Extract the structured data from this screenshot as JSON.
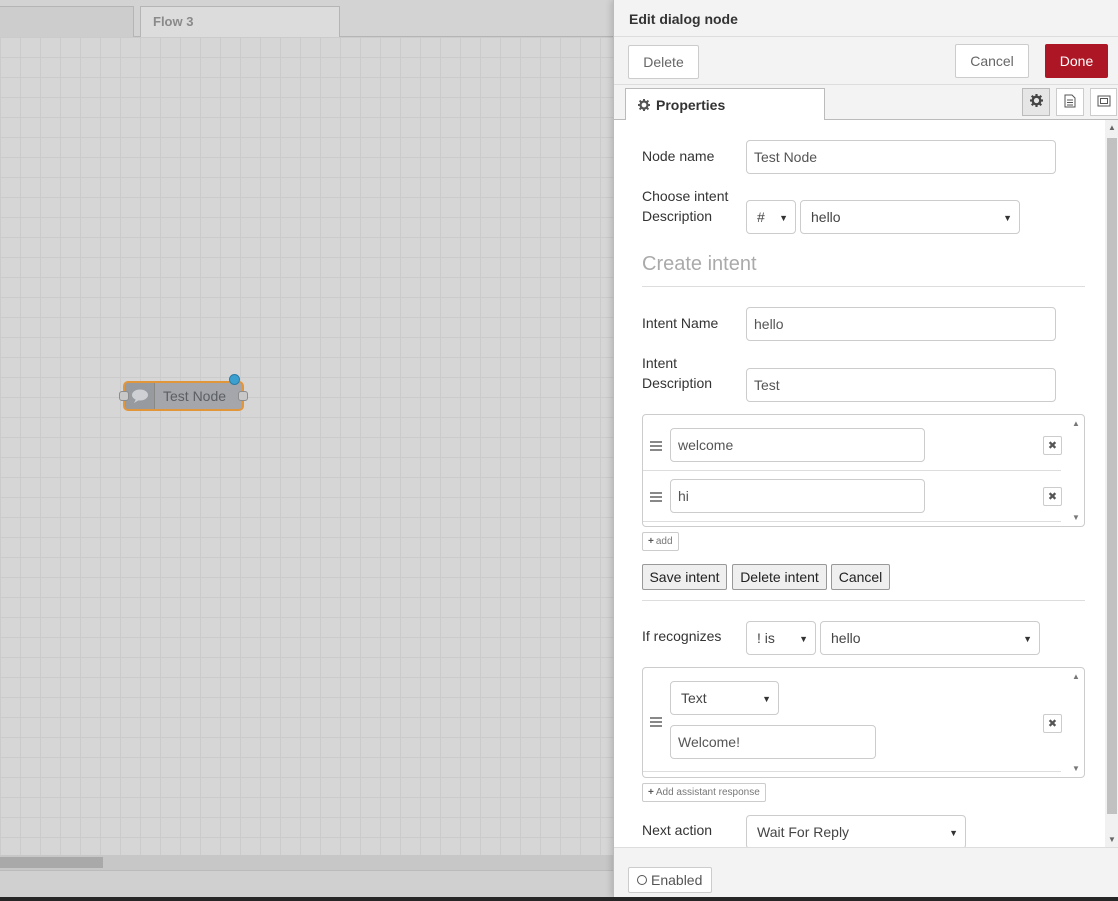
{
  "workspace": {
    "tabs": [
      {
        "label": ""
      },
      {
        "label": "Flow 3"
      }
    ],
    "node": {
      "label": "Test Node",
      "icon": "speech-bubble-icon",
      "status_color": "#3b9fd0",
      "border_color": "#e2963c"
    }
  },
  "editor": {
    "title": "Edit dialog node",
    "delete_label": "Delete",
    "cancel_label": "Cancel",
    "done_label": "Done",
    "done_color": "#ad1625",
    "properties_tab": "Properties",
    "tab_icons": [
      "gear-icon",
      "document-icon",
      "appearance-icon"
    ],
    "node_name": {
      "label": "Node name",
      "value": "Test Node"
    },
    "choose_intent": {
      "label_line1": "Choose intent",
      "label_line2": "Description",
      "prefix": "#",
      "value": "hello"
    },
    "create_intent": {
      "title": "Create intent",
      "name_label": "Intent Name",
      "name_value": "hello",
      "desc_label_line1": "Intent",
      "desc_label_line2": "Description",
      "desc_value": "Test",
      "examples": [
        "welcome",
        "hi"
      ],
      "add_label": "add",
      "save_label": "Save intent",
      "delete_label": "Delete intent",
      "cancel_label": "Cancel"
    },
    "if_recognizes": {
      "label": "If recognizes",
      "operator": "! is",
      "value": "hello"
    },
    "responses": [
      {
        "type": "Text",
        "value": "Welcome!"
      }
    ],
    "add_response_label": "Add assistant response",
    "next_action": {
      "label": "Next action",
      "value": "Wait For Reply"
    },
    "enabled_label": "Enabled"
  }
}
